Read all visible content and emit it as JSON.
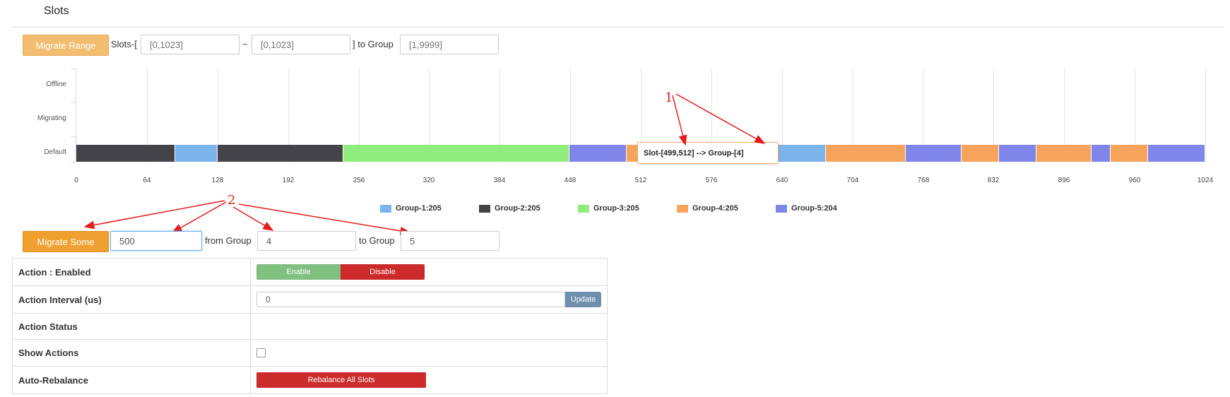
{
  "page": {
    "title": "Slots"
  },
  "range_form": {
    "button_label": "Migrate Range",
    "slots_prefix": "Slots-[",
    "from_placeholder": "[0,1023]",
    "tilde": "~",
    "to_placeholder": "[0,1023]",
    "to_group_label": "] to Group",
    "group_placeholder": "[1,9999]"
  },
  "chart_data": {
    "type": "bar",
    "orientation": "horizontal",
    "rows": [
      "Offline",
      "Migrating",
      "Default"
    ],
    "x_ticks": [
      "0",
      "64",
      "128",
      "192",
      "256",
      "320",
      "384",
      "448",
      "512",
      "576",
      "640",
      "704",
      "768",
      "832",
      "896",
      "960",
      "1024"
    ],
    "xlim": [
      0,
      1024
    ],
    "grid": true,
    "legend_position": "bottom",
    "colors": {
      "Group-1": "#7cb5ec",
      "Group-2": "#434348",
      "Group-3": "#90ed7d",
      "Group-4": "#f7a35c",
      "Group-5": "#8085e9"
    },
    "legend": [
      {
        "name": "Group-1",
        "label": "Group-1:205"
      },
      {
        "name": "Group-2",
        "label": "Group-2:205"
      },
      {
        "name": "Group-3",
        "label": "Group-3:205"
      },
      {
        "name": "Group-4",
        "label": "Group-4:205"
      },
      {
        "name": "Group-5",
        "label": "Group-5:204"
      }
    ],
    "segments": [
      {
        "row": "Default",
        "start": 0,
        "end": 90,
        "group": "Group-2"
      },
      {
        "row": "Default",
        "start": 90,
        "end": 128,
        "group": "Group-1"
      },
      {
        "row": "Default",
        "start": 128,
        "end": 242,
        "group": "Group-2"
      },
      {
        "row": "Default",
        "start": 242,
        "end": 447,
        "group": "Group-3"
      },
      {
        "row": "Default",
        "start": 447,
        "end": 499,
        "group": "Group-5"
      },
      {
        "row": "Default",
        "start": 499,
        "end": 512,
        "group": "Group-4"
      },
      {
        "row": "Default",
        "start": 512,
        "end": 680,
        "group": "Group-1"
      },
      {
        "row": "Default",
        "start": 680,
        "end": 752,
        "group": "Group-4"
      },
      {
        "row": "Default",
        "start": 752,
        "end": 803,
        "group": "Group-5"
      },
      {
        "row": "Default",
        "start": 803,
        "end": 837,
        "group": "Group-4"
      },
      {
        "row": "Default",
        "start": 837,
        "end": 871,
        "group": "Group-5"
      },
      {
        "row": "Default",
        "start": 871,
        "end": 921,
        "group": "Group-4"
      },
      {
        "row": "Default",
        "start": 921,
        "end": 938,
        "group": "Group-5"
      },
      {
        "row": "Default",
        "start": 938,
        "end": 972,
        "group": "Group-4"
      },
      {
        "row": "Default",
        "start": 972,
        "end": 1024,
        "group": "Group-5"
      }
    ],
    "tooltip": "Slot-[499,512] --> Group-[4]"
  },
  "annotations": {
    "one": "1",
    "two": "2"
  },
  "some_form": {
    "button_label": "Migrate Some",
    "count_value": "500",
    "from_group_label": "from Group",
    "from_group_value": "4",
    "to_group_label": "to Group",
    "to_group_value": "5"
  },
  "settings": {
    "action_label": "Action : Enabled",
    "enable_label": "Enable",
    "disable_label": "Disable",
    "interval_label": "Action Interval (us)",
    "interval_value": "0",
    "update_label": "Update",
    "status_label": "Action Status",
    "show_actions_label": "Show Actions",
    "auto_rebalance_label": "Auto-Rebalance",
    "rebalance_button": "Rebalance All Slots"
  }
}
